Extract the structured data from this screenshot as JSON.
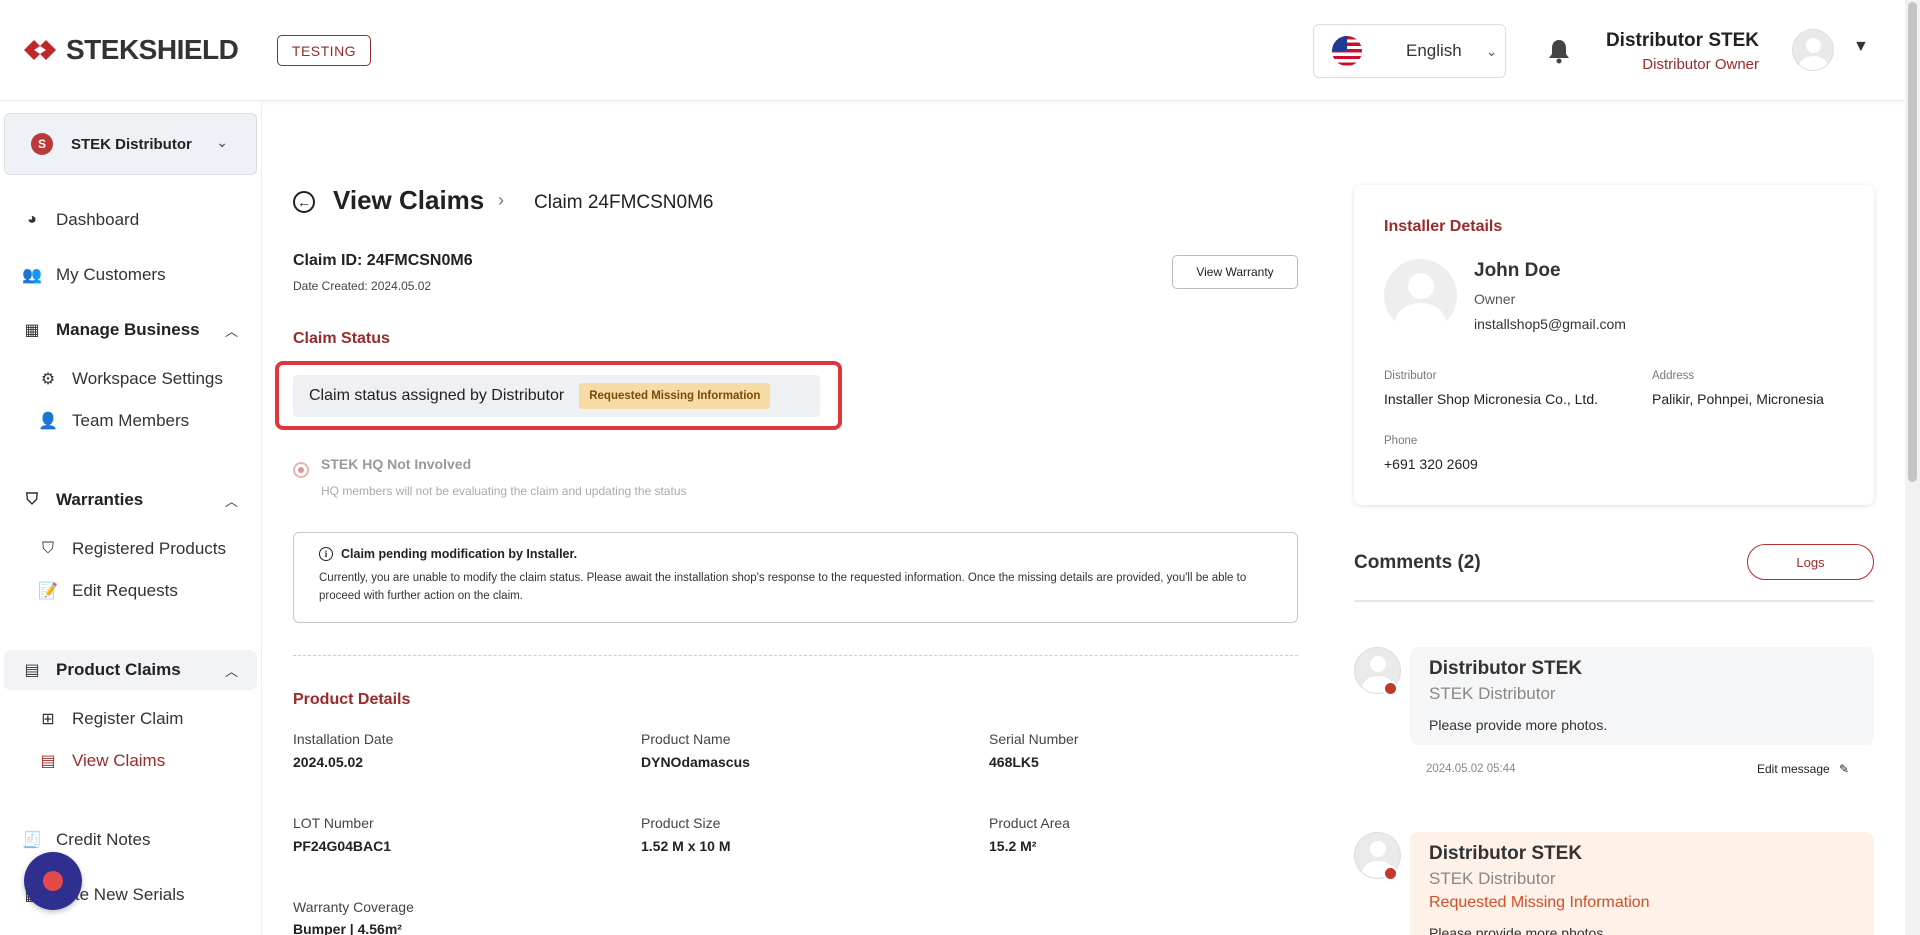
{
  "header": {
    "brand": "STEKSHIELD",
    "env_badge": "TESTING",
    "language": "English",
    "user_name": "Distributor STEK",
    "user_role": "Distributor Owner"
  },
  "sidebar": {
    "org_name": "STEK Distributor",
    "items": {
      "dashboard": "Dashboard",
      "my_customers": "My Customers",
      "manage_business": "Manage Business",
      "workspace_settings": "Workspace Settings",
      "team_members": "Team Members",
      "warranties": "Warranties",
      "registered_products": "Registered Products",
      "edit_requests": "Edit Requests",
      "product_claims": "Product Claims",
      "register_claim": "Register Claim",
      "view_claims": "View Claims",
      "credit_notes": "Credit Notes",
      "create_new_serials": "eate New Serials"
    }
  },
  "main": {
    "title": "View Claims",
    "breadcrumb": "Claim 24FMCSN0M6",
    "claim_id": "Claim ID: 24FMCSN0M6",
    "date_created": "Date Created: 2024.05.02",
    "view_warranty": "View Warranty",
    "claim_status_title": "Claim Status",
    "status_text": "Claim status assigned by Distributor",
    "status_badge": "Requested Missing Information",
    "radio_label": "STEK HQ Not Involved",
    "radio_desc": "HQ members will not be evaluating the claim and updating the status",
    "notice_title": "Claim pending modification by Installer.",
    "notice_body": "Currently, you are unable to modify the claim status. Please await the installation shop's response to the requested information. Once the missing details are provided, you'll be able to proceed with further action on the claim.",
    "product_details_title": "Product Details",
    "fields": {
      "installation_date_label": "Installation Date",
      "installation_date": "2024.05.02",
      "product_name_label": "Product Name",
      "product_name": "DYNOdamascus",
      "serial_number_label": "Serial Number",
      "serial_number": "468LK5",
      "lot_number_label": "LOT Number",
      "lot_number": "PF24G04BAC1",
      "product_size_label": "Product Size",
      "product_size": "1.52 M x 10 M",
      "product_area_label": "Product Area",
      "product_area": "15.2 M²",
      "warranty_coverage_label": "Warranty Coverage",
      "warranty_coverage": "Bumper | 4.56m²"
    }
  },
  "installer": {
    "title": "Installer Details",
    "name": "John Doe",
    "role": "Owner",
    "email": "installshop5@gmail.com",
    "distributor_label": "Distributor",
    "distributor": "Installer Shop Micronesia Co., Ltd.",
    "address_label": "Address",
    "address": "Palikir, Pohnpei, Micronesia",
    "phone_label": "Phone",
    "phone": "+691 320 2609"
  },
  "comments": {
    "title": "Comments (2)",
    "logs_label": "Logs",
    "items": [
      {
        "author": "Distributor STEK",
        "org": "STEK Distributor",
        "text": "Please provide more photos.",
        "time": "2024.05.02 05:44",
        "edit_label": "Edit message"
      },
      {
        "author": "Distributor STEK",
        "org": "STEK Distributor",
        "status": "Requested Missing Information",
        "text": "Please provide more photos."
      }
    ]
  },
  "colors": {
    "accent": "#9b2a2a",
    "highlight": "#e0353a",
    "badge_bg": "#f6dca4"
  }
}
